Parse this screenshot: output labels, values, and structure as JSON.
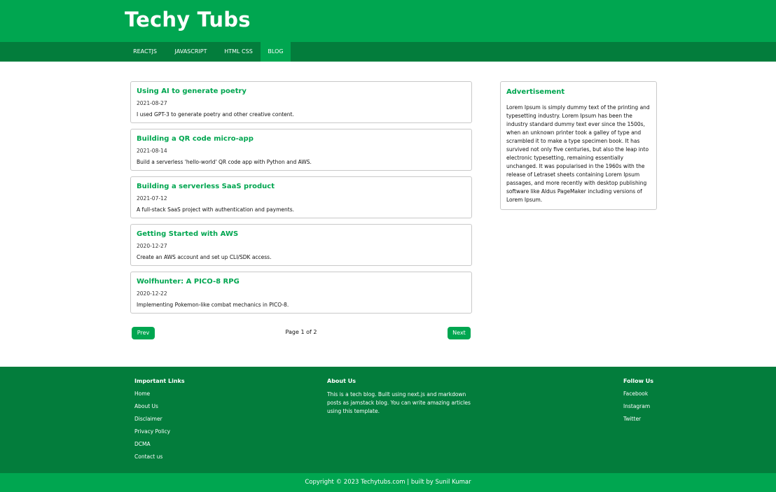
{
  "site": {
    "title": "Techy Tubs"
  },
  "nav": {
    "items": [
      {
        "label": "REACTJS"
      },
      {
        "label": "JAVASCRIPT"
      },
      {
        "label": "HTML CSS"
      },
      {
        "label": "BLOG",
        "active": true
      }
    ]
  },
  "posts": [
    {
      "title": "Using AI to generate poetry",
      "date": "2021-08-27",
      "description": "I used GPT-3 to generate poetry and other creative content."
    },
    {
      "title": "Building a QR code micro-app",
      "date": "2021-08-14",
      "description": "Build a serverless 'hello-world' QR code app with Python and AWS."
    },
    {
      "title": "Building a serverless SaaS product",
      "date": "2021-07-12",
      "description": "A full-stack SaaS project with authentication and payments."
    },
    {
      "title": "Getting Started with AWS",
      "date": "2020-12-27",
      "description": "Create an AWS account and set up CLI/SDK access."
    },
    {
      "title": "Wolfhunter: A PICO-8 RPG",
      "date": "2020-12-22",
      "description": "Implementing Pokemon-like combat mechanics in PICO-8."
    }
  ],
  "pagination": {
    "prev_label": "Prev",
    "next_label": "Next",
    "page_text": "Page 1 of 2"
  },
  "sidebar": {
    "ad_title": "Advertisement",
    "ad_text": "Lorem Ipsum is simply dummy text of the printing and typesetting industry. Lorem Ipsum has been the industry standard dummy text ever since the 1500s, when an unknown printer took a galley of type and scrambled it to make a type specimen book. It has survived not only five centuries, but also the leap into electronic typesetting, remaining essentially unchanged. It was popularised in the 1960s with the release of Letraset sheets containing Lorem Ipsum passages, and more recently with desktop publishing software like Aldus PageMaker including versions of Lorem Ipsum."
  },
  "footer": {
    "links_heading": "Important Links",
    "links": [
      "Home",
      "About Us",
      "Disclaimer",
      "Privacy Policy",
      "DCMA",
      "Contact us"
    ],
    "about_heading": "About Us",
    "about_text": "This is a tech blog. Built using next.js and markdown posts as jamstack blog. You can write amazing articles using this template.",
    "follow_heading": "Follow Us",
    "social": [
      "Facebook",
      "Instagram",
      "Twitter"
    ],
    "copyright": "Copyright © 2023 Techytubs.com | built by Sunil Kumar"
  },
  "colors": {
    "primary": "#00a650",
    "dark": "#037d3c"
  }
}
